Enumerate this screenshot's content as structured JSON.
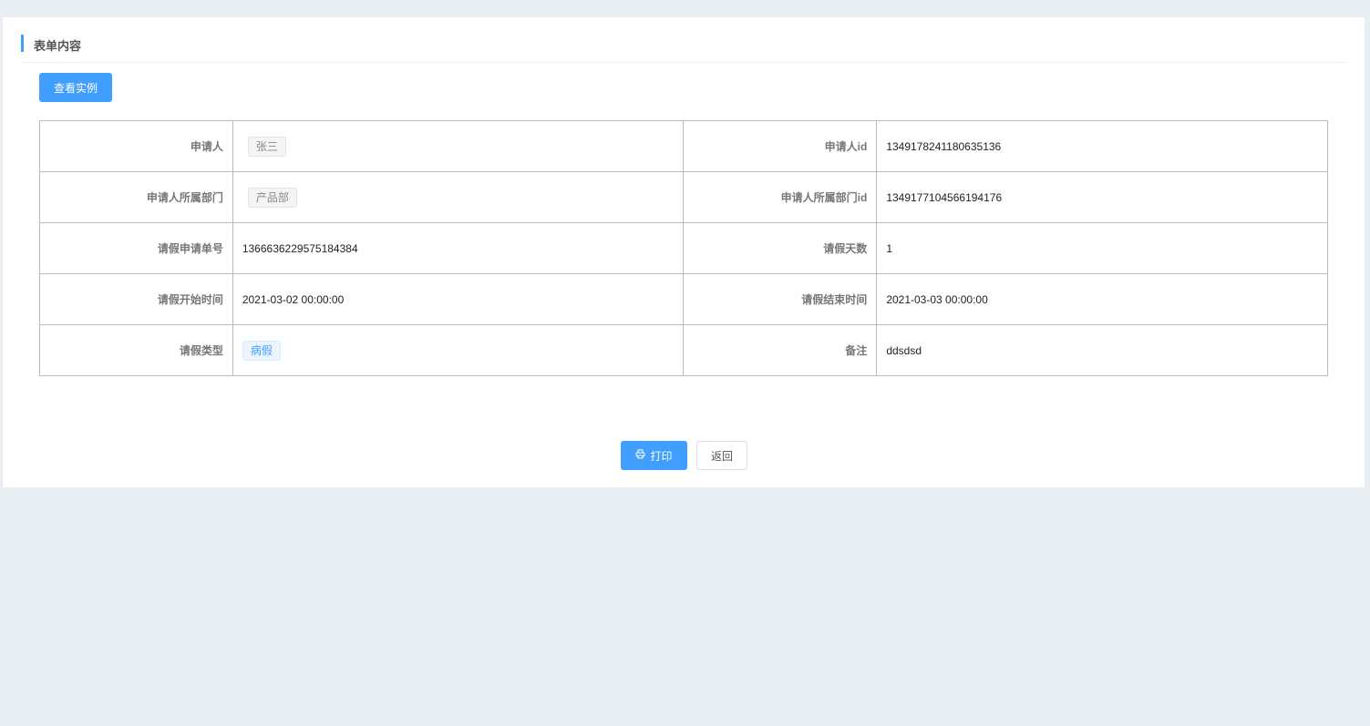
{
  "section_title": "表单内容",
  "view_instance_label": "查看实例",
  "rows": [
    {
      "l1": "申请人",
      "v1": "张三",
      "l2": "申请人id",
      "v2": "1349178241180635136"
    },
    {
      "l1": "申请人所属部门",
      "v1": "产品部",
      "l2": "申请人所属部门id",
      "v2": "1349177104566194176"
    },
    {
      "l1": "请假申请单号",
      "v1": "1366636229575184384",
      "l2": "请假天数",
      "v2": "1"
    },
    {
      "l1": "请假开始时间",
      "v1": "2021-03-02 00:00:00",
      "l2": "请假结束时间",
      "v2": "2021-03-03 00:00:00"
    },
    {
      "l1": "请假类型",
      "v1": "病假",
      "l2": "备注",
      "v2": "ddsdsd"
    }
  ],
  "print_label": "打印",
  "back_label": "返回",
  "accent": "#409eff"
}
